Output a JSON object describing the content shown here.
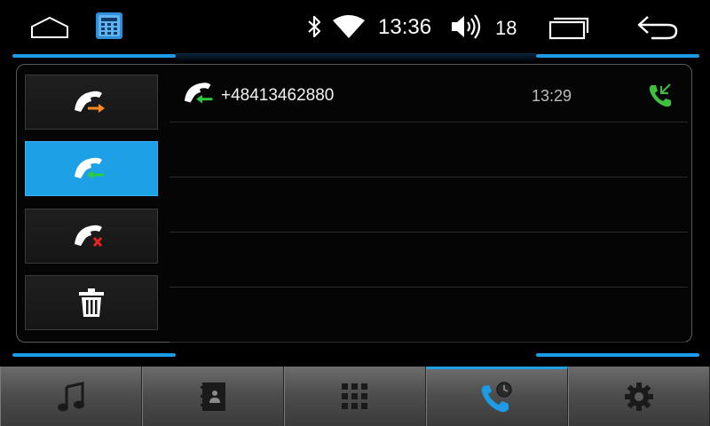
{
  "status_bar": {
    "time": "13:36",
    "volume_level": "18",
    "icons": [
      "home-icon",
      "dialer-app-icon",
      "bluetooth-icon",
      "wifi-icon",
      "volume-icon",
      "recent-apps-icon",
      "back-icon"
    ]
  },
  "call_log": {
    "filters": [
      {
        "name": "outgoing-calls",
        "icon": "outgoing-call-icon",
        "active": false
      },
      {
        "name": "incoming-calls",
        "icon": "incoming-call-icon",
        "active": true
      },
      {
        "name": "missed-calls",
        "icon": "missed-call-icon",
        "active": false
      },
      {
        "name": "delete-calls",
        "icon": "trash-icon",
        "active": false
      }
    ],
    "entries": [
      {
        "number": "+48413462880",
        "time": "13:29",
        "type": "incoming"
      }
    ]
  },
  "bottom_nav": {
    "items": [
      "music-icon",
      "contacts-icon",
      "dialpad-icon",
      "call-history-icon",
      "settings-icon"
    ],
    "active_index": 3
  },
  "colors": {
    "accent": "#1ea0e6",
    "incoming_arrow": "#2ecc40",
    "outgoing_arrow": "#ff8a1e",
    "missed_mark": "#e52222",
    "call_button": "#3fbf3f"
  }
}
